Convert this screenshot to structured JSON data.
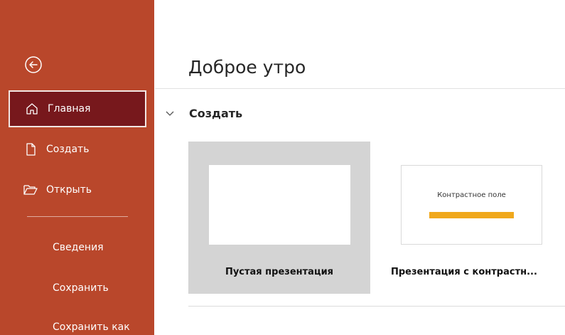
{
  "sidebar": {
    "back_label": "",
    "items": [
      {
        "label": "Главная",
        "icon": "home-icon"
      },
      {
        "label": "Создать",
        "icon": "new-file-icon"
      },
      {
        "label": "Открыть",
        "icon": "folder-open-icon"
      }
    ],
    "secondary": [
      {
        "label": "Сведения"
      },
      {
        "label": "Сохранить"
      },
      {
        "label": "Сохранить как"
      }
    ],
    "colors": {
      "background": "#b9472b",
      "active": "#77181c"
    }
  },
  "main": {
    "greeting": "Доброе утро",
    "section": {
      "title": "Создать",
      "templates": [
        {
          "caption": "Пустая презентация"
        },
        {
          "caption": "Презентация с контрастн...",
          "thumb_title": "Контрастное поле"
        }
      ]
    }
  }
}
